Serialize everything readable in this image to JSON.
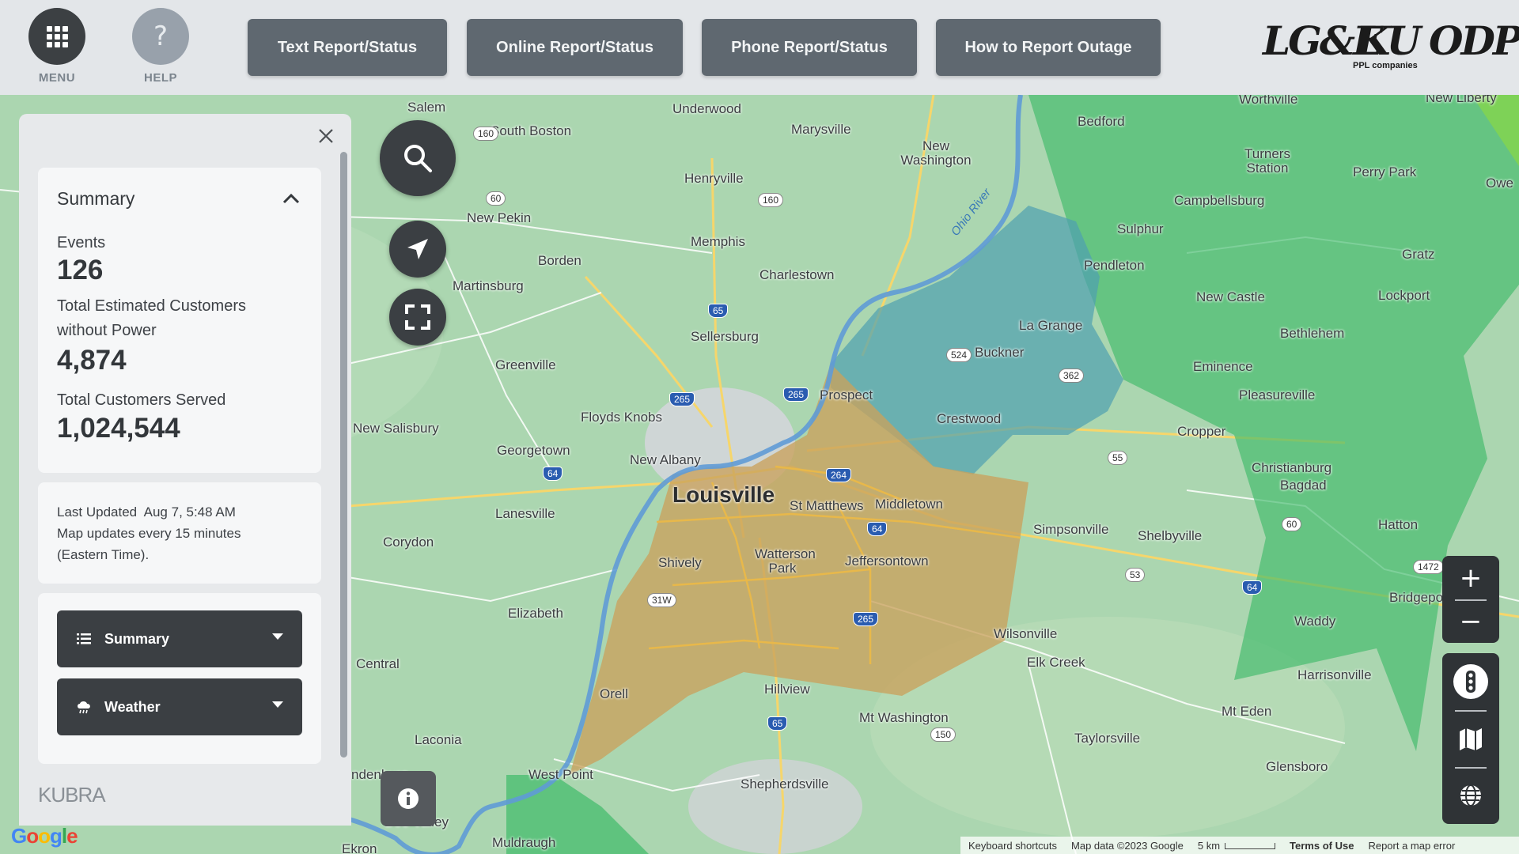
{
  "topbar": {
    "menu_label": "MENU",
    "help_label": "HELP",
    "help_glyph": "?",
    "buttons": [
      {
        "label": "Text Report/Status"
      },
      {
        "label": "Online Report/Status"
      },
      {
        "label": "Phone Report/Status"
      },
      {
        "label": "How to Report Outage"
      }
    ],
    "logos": {
      "lge": "LG&E",
      "ku": "KU",
      "odp": "ODP",
      "ppl_caption": "PPL companies"
    }
  },
  "panel": {
    "summary": {
      "title": "Summary",
      "events_label": "Events",
      "events_value": "126",
      "customers_out_label_line1": "Total Estimated Customers",
      "customers_out_label_line2": "without Power",
      "customers_out_value": "4,874",
      "customers_served_label": "Total Customers Served",
      "customers_served_value": "1,024,544"
    },
    "update": {
      "last_updated": "Last Updated  Aug 7, 5:48 AM",
      "line2": "Map updates every 15 minutes",
      "line3": "(Eastern Time)."
    },
    "dropdowns": [
      {
        "label": "Summary",
        "icon": "list-icon"
      },
      {
        "label": "Weather",
        "icon": "weather-icon"
      }
    ],
    "brand": "KUBRA"
  },
  "map": {
    "cities": {
      "louisville": "Louisville",
      "salem": "Salem",
      "underwood": "Underwood",
      "marysville": "Marysville",
      "new_washington": "New Washington",
      "south_boston": "South Boston",
      "henryville": "Henryville",
      "new_pekin": "New Pekin",
      "memphis": "Memphis",
      "borden": "Borden",
      "charlestown": "Charlestown",
      "martinsburg": "Martinsburg",
      "sellersburg": "Sellersburg",
      "greenville": "Greenville",
      "prospect": "Prospect",
      "floyds_knobs": "Floyds Knobs",
      "new_salisbury": "New Salisbury",
      "georgetown": "Georgetown",
      "new_albany": "New Albany",
      "lanesville": "Lanesville",
      "corydon": "Corydon",
      "elizabeth": "Elizabeth",
      "central": "Central",
      "laconia": "Laconia",
      "west_point": "West Point",
      "muldraugh": "Muldraugh",
      "orell": "Orell",
      "hillview": "Hillview",
      "shepherdsville": "Shepherdsville",
      "mt_washington": "Mt Washington",
      "shively": "Shively",
      "watterson_park": "Watterson Park",
      "st_matthews": "St Matthews",
      "middletown": "Middletown",
      "jeffersontown": "Jeffersontown",
      "crestwood": "Crestwood",
      "buckner": "Buckner",
      "la_grange": "La Grange",
      "pendleton": "Pendleton",
      "sulphur": "Sulphur",
      "bedford": "Bedford",
      "worthville": "Worthville",
      "turners_station": "Turners Station",
      "campbellsburg": "Campbellsburg",
      "perry_park": "Perry Park",
      "new_castle": "New Castle",
      "gratz": "Gratz",
      "lockport": "Lockport",
      "bethlehem": "Bethlehem",
      "eminence": "Eminence",
      "pleasureville": "Pleasureville",
      "cropper": "Cropper",
      "christianburg": "Christianburg",
      "bagdad": "Bagdad",
      "simpsonville": "Simpsonville",
      "shelbyville": "Shelbyville",
      "hatton": "Hatton",
      "wilsonville": "Wilsonville",
      "elk_creek": "Elk Creek",
      "waddy": "Waddy",
      "harrisonville": "Harrisonville",
      "taylorsville": "Taylorsville",
      "mt_eden": "Mt Eden",
      "glensboro": "Glensboro",
      "bridgeport": "Bridgepo",
      "new_liberty": "New Liberty",
      "owen": "Owe",
      "ekron": "Ekron",
      "brandenburg": "ndenburg",
      "doe_valley": "Doe Valley"
    },
    "river_label": "Ohio River",
    "footer": {
      "shortcuts": "Keyboard shortcuts",
      "map_data": "Map data ©2023 Google",
      "scale": "5 km",
      "terms": "Terms of Use",
      "report": "Report a map error"
    },
    "google": "Google",
    "colors": {
      "lge_area": "#c9a25c",
      "ku_area": "#3fba6a",
      "overlap_area": "#4f9fb0",
      "panel_bg": "#e7e9eb",
      "button_bg": "#5f6870"
    }
  }
}
